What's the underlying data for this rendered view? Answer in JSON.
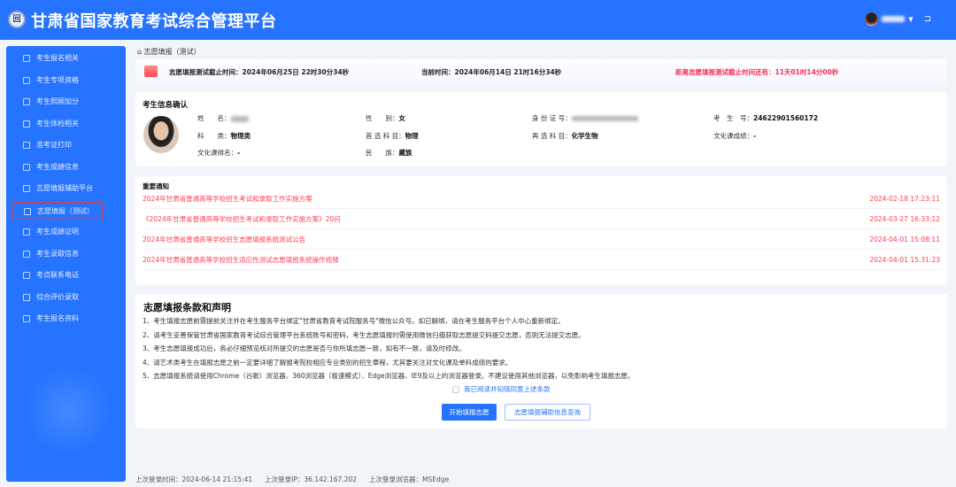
{
  "header": {
    "logo_text": "回",
    "title": "甘肃省国家教育考试综合管理平台"
  },
  "sidebar": {
    "items": [
      {
        "label": "考生报名相关",
        "icon": "file-icon"
      },
      {
        "label": "考生专项资格",
        "icon": "v-icon"
      },
      {
        "label": "考生照顾加分",
        "icon": "card-icon"
      },
      {
        "label": "考生体检相关",
        "icon": "heart-icon"
      },
      {
        "label": "准考证打印",
        "icon": "id-card-icon"
      },
      {
        "label": "考生成绩信息",
        "icon": "id-card-icon"
      },
      {
        "label": "志愿填报辅助平台",
        "icon": "form-icon"
      },
      {
        "label": "志愿填报（测试）",
        "icon": "form-icon",
        "active": true
      },
      {
        "label": "考生成绩证明",
        "icon": "form-icon"
      },
      {
        "label": "考生录取信息",
        "icon": "bookmark-icon"
      },
      {
        "label": "考点联系电话",
        "icon": "bookmark-icon"
      },
      {
        "label": "综合评价录取",
        "icon": "form-icon"
      },
      {
        "label": "考生报名资料",
        "icon": "id-card-icon"
      }
    ]
  },
  "breadcrumb": {
    "icon": "home-icon",
    "label": "志愿填报（测试）"
  },
  "banner": {
    "deadline": "志愿填报测试截止时间：2024年06月25日 22时30分34秒",
    "current": "当前时间：2024年06月14日 21时16分34秒",
    "countdown": "距离志愿填报测试截止时间还有：11天01时14分00秒",
    "countdown_color": "#ff2d55"
  },
  "info": {
    "title": "考生信息确认",
    "fields": {
      "name_label": "姓　　名：",
      "gender_label": "性　　别：",
      "gender": "女",
      "id_label": "身 份 证 号：",
      "exam_no_label": "考　生　号：",
      "exam_no": "24622901560172",
      "category_label": "科　　类：",
      "category": "物理类",
      "first_label": "首 选 科 目：",
      "first": "物理",
      "second_label": "再 选 科 目：",
      "second": "化学生物",
      "culture_score_label": "文化课成绩：",
      "culture_score": "-",
      "culture_rank_label": "文化课排名：",
      "culture_rank": "-",
      "ethnic_label": "民　　族：",
      "ethnic": "藏族"
    }
  },
  "notice": {
    "title": "重要通知",
    "items": [
      {
        "title": "2024年甘肃省普通高等学校招生考试和录取工作实施方案",
        "date": "2024-02-18 17:23:11"
      },
      {
        "title": "《2024年甘肃省普通高等学校招生考试和录取工作实施方案》20问",
        "date": "2024-03-27 16:33:12"
      },
      {
        "title": "2024年甘肃省普通高等学校招生志愿填报系统测试公告",
        "date": "2024-04-01 15:08:11"
      },
      {
        "title": "2024年甘肃省普通高等学校招生适应性测试志愿填报系统操作视频",
        "date": "2024-04-01 15:31:23"
      }
    ]
  },
  "terms": {
    "title": "志愿填报条款和声明",
    "lines": [
      "1、考生填报志愿前需提前关注并在考生服务平台绑定\"甘肃省教育考试院服务号\"微信公众号。如已解绑，请在考生服务平台个人中心重新绑定。",
      "2、请考生妥善保管甘肃省国家教育考试综合管理平台系统账号和密码，考生志愿填报时需使用微信扫描获取志愿提交码提交志愿，否则无法提交志愿。",
      "3、考生志愿填报成功后，务必仔细预览核对所提交的志愿是否与你所填志愿一致，如有不一致，请及时修改。",
      "4、请艺术类考生在填报志愿之前一定要详细了解报考院校相应专业类别的招生章程，尤其要关注对文化课及单科成绩的要求。",
      "5、志愿填报系统请使用Chrome（谷歌）浏览器、360浏览器（极速模式）、Edge浏览器、IE9及以上的浏览器登录。不建议使用其他浏览器，以免影响考生填报志愿。"
    ],
    "agree_label": "我已阅读并知晓同意上述条款",
    "agree_checked": false,
    "start_button": "开始填报志愿",
    "aux_button": "志愿填报辅助信息查询"
  },
  "footer": {
    "last_login_time": "上次登录时间：2024-06-14 21:15:41",
    "last_login_ip": "上次登录IP：36.142.167.202",
    "last_login_browser": "上次登录浏览器：MSEdge"
  },
  "colors": {
    "primary": "#2673ff",
    "alert": "#ff3d52"
  }
}
